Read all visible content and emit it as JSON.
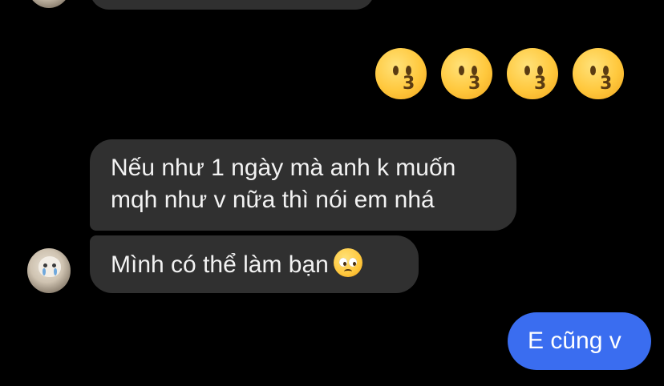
{
  "conversation": {
    "messages": [
      {
        "from": "other",
        "lines": [
          "Nếu như 1 ngày mà anh k muốn",
          "mqh như v nữa thì nói em nhá"
        ]
      },
      {
        "from": "other",
        "text": "Mình có thể làm bạn",
        "emoji": "pleading-face"
      },
      {
        "from": "me",
        "text": "E cũng v"
      }
    ],
    "reaction_emojis": [
      "kissing-face",
      "kissing-face",
      "kissing-face",
      "kissing-face"
    ]
  },
  "colors": {
    "background": "#000000",
    "incoming_bubble": "#303030",
    "outgoing_bubble": "#3a6df0",
    "text": "#f2f2f2"
  }
}
